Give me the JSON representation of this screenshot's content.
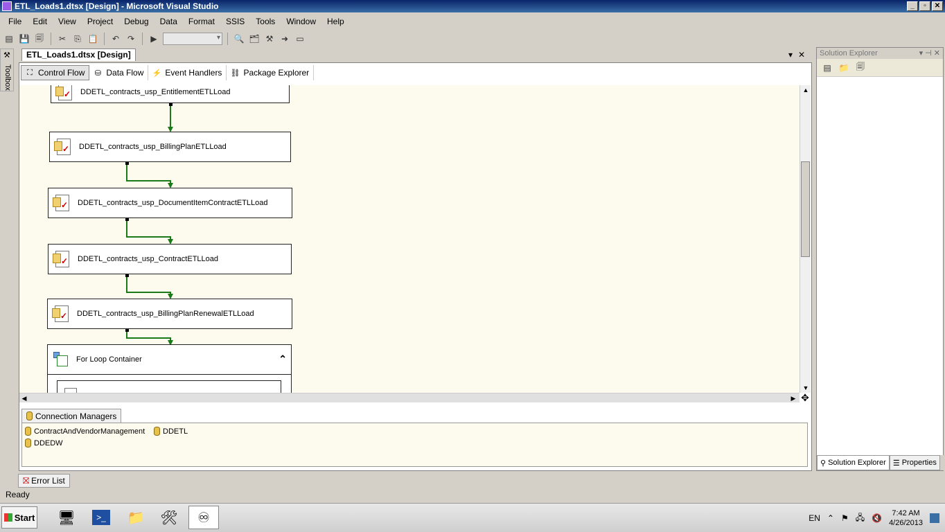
{
  "window": {
    "title": "ETL_Loads1.dtsx [Design] - Microsoft Visual Studio"
  },
  "menu": [
    "File",
    "Edit",
    "View",
    "Project",
    "Debug",
    "Data",
    "Format",
    "SSIS",
    "Tools",
    "Window",
    "Help"
  ],
  "toolbox": {
    "label": "Toolbox"
  },
  "document": {
    "tab_label": "ETL_Loads1.dtsx [Design]"
  },
  "designer_tabs": [
    "Control Flow",
    "Data Flow",
    "Event Handlers",
    "Package Explorer"
  ],
  "tasks": [
    "DDETL_contracts_usp_EntitlementETLLoad",
    "DDETL_contracts_usp_BillingPlanETLLoad",
    "DDETL_contracts_usp_DocumentItemContractETLLoad",
    "DDETL_contracts_usp_ContractETLLoad",
    "DDETL_contracts_usp_BillingPlanRenewalETLLoad"
  ],
  "loop_container": {
    "label": "For Loop Container"
  },
  "connection_managers": {
    "tab_label": "Connection Managers",
    "items": [
      "ContractAndVendorManagement",
      "DDETL",
      "DDEDW"
    ]
  },
  "solution_explorer": {
    "title": "Solution Explorer",
    "tabs": [
      "Solution Explorer",
      "Properties"
    ]
  },
  "error_list": {
    "label": "Error List"
  },
  "status": {
    "text": "Ready"
  },
  "taskbar": {
    "start_label": "Start",
    "language": "EN",
    "time": "7:42 AM",
    "date": "4/26/2013"
  },
  "colors": {
    "precedence_success": "#1a7a1a",
    "canvas_bg": "#fdfaee"
  }
}
